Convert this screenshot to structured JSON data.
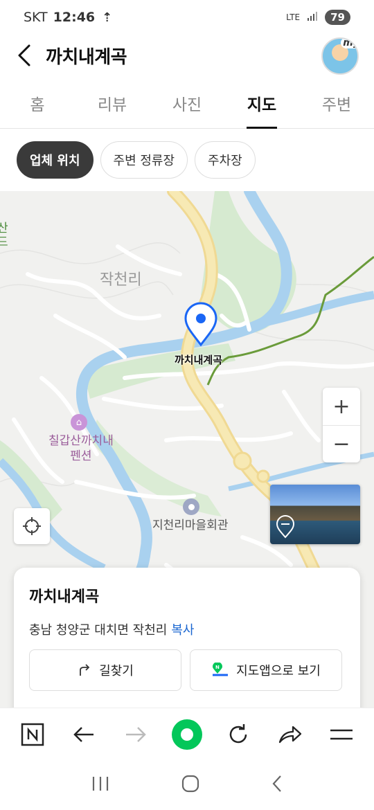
{
  "status": {
    "carrier": "SKT",
    "time": "12:46",
    "network": "LTE",
    "battery": "79"
  },
  "header": {
    "title": "까치내계곡",
    "avatar_tag": "my"
  },
  "tabs": [
    {
      "label": "홈"
    },
    {
      "label": "리뷰"
    },
    {
      "label": "사진"
    },
    {
      "label": "지도",
      "active": true
    },
    {
      "label": "주변"
    }
  ],
  "chips": [
    {
      "label": "업체 위치",
      "active": true
    },
    {
      "label": "주변 정류장"
    },
    {
      "label": "주차장"
    }
  ],
  "map": {
    "place_label": "작천리",
    "pin_label": "까치내계곡",
    "poi_label_line1": "칠갑산까치내",
    "poi_label_line2": "펜션",
    "hall_label": "지천리마을회관",
    "edge_label_line1": "산",
    "edge_label_line2": "드",
    "zoom_in": "+",
    "zoom_out": "−",
    "colors": {
      "road": "#f5e3a1",
      "river": "#a9d1ef",
      "green": "#d6ead0",
      "trail": "#6a9b3a",
      "pin": "#1a66f5"
    }
  },
  "card": {
    "title": "까치내계곡",
    "address": "충남 청양군 대치면 작천리",
    "copy_label": "복사",
    "directions_label": "길찾기",
    "map_app_label": "지도앱으로 보기"
  },
  "bottom_nav": {
    "icons": [
      "naver-n-icon",
      "back-arrow-icon",
      "forward-arrow-icon",
      "home-dot-icon",
      "refresh-icon",
      "share-icon",
      "menu-icon"
    ]
  }
}
